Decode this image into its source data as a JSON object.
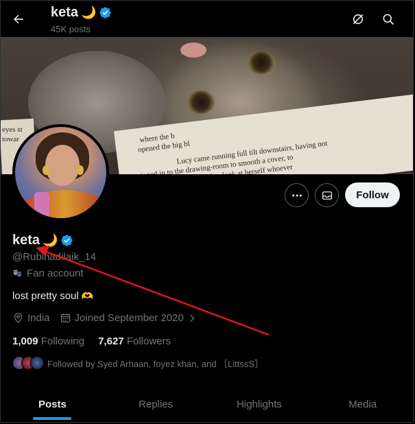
{
  "header": {
    "name": "keta",
    "name_emoji": "🌙",
    "posts_count": "45K posts"
  },
  "profile": {
    "name": "keta",
    "name_emoji": "🌙",
    "handle": "@Rubinadilaik_14",
    "category_icon": "theater-masks-icon",
    "category": "Fan account",
    "bio": "lost pretty soul",
    "bio_emoji": "🫶",
    "location": "India",
    "joined": "Joined September 2020",
    "following_count": "1,009",
    "following_label": "Following",
    "followers_count": "7,627",
    "followers_label": "Followers",
    "followed_by": "Followed by Syed Arhaan, foyez khan, and ［LittssS］"
  },
  "actions": {
    "follow_label": "Follow"
  },
  "banner": {
    "paper_text": [
      "where the b",
      "opened the big bl",
      "Lucy came running full tilt downstairs, having not",
      "nipped in to the drawing-room to smooth a cover, to",
      "straighten a cushion, and to look at herself whoever"
    ],
    "left_text": [
      "eyes st",
      "towar"
    ]
  },
  "tabs": [
    {
      "label": "Posts",
      "active": true
    },
    {
      "label": "Replies",
      "active": false
    },
    {
      "label": "Highlights",
      "active": false
    },
    {
      "label": "Media",
      "active": false
    }
  ],
  "colors": {
    "accent": "#1d9bf0",
    "verified": "#1d9bf0",
    "annotation": "#e3161a",
    "moon": "#f4c542"
  }
}
